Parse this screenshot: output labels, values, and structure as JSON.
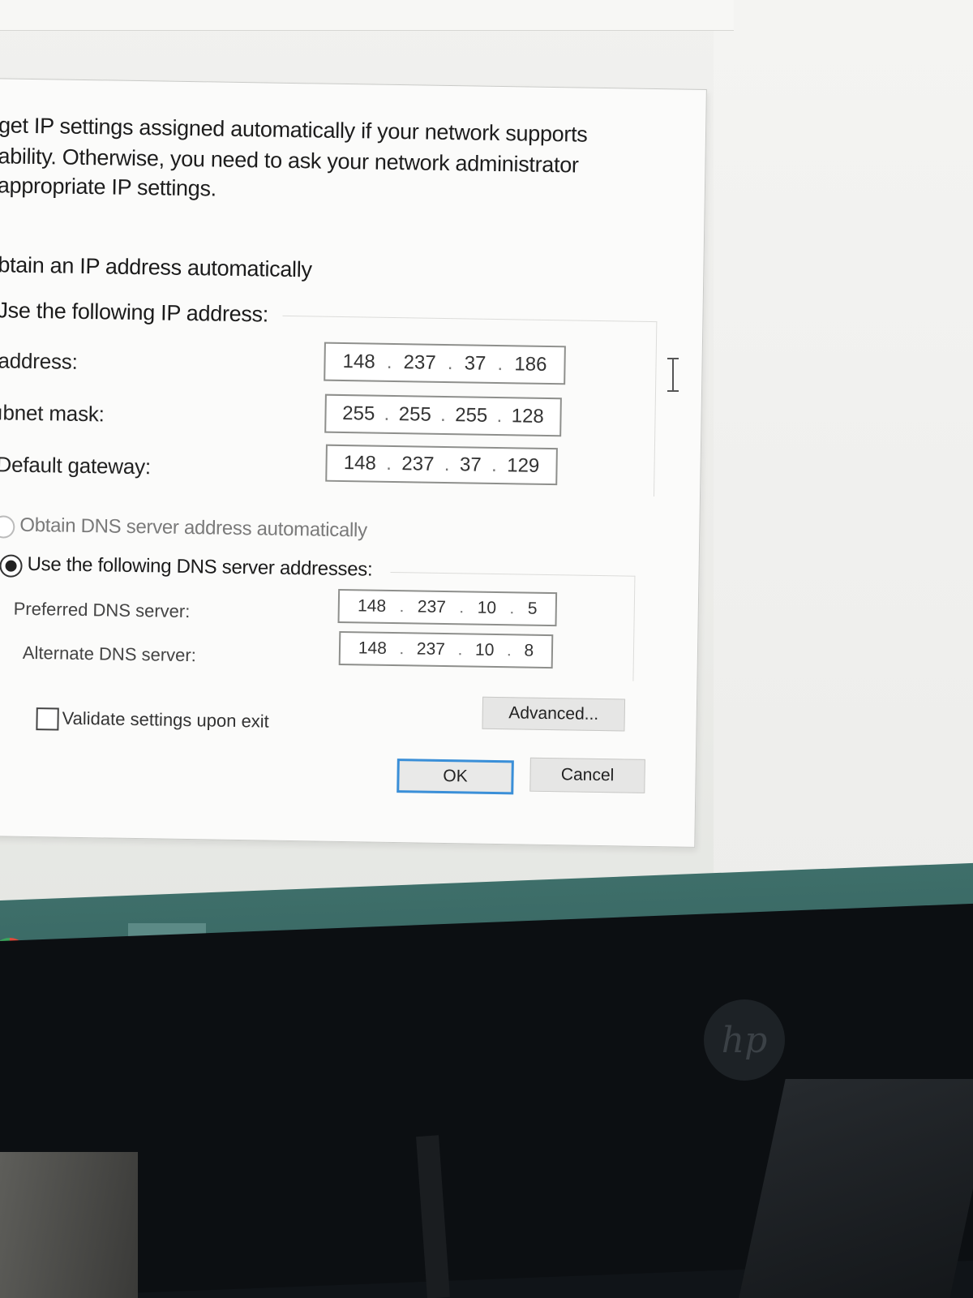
{
  "dialog": {
    "description_lines": [
      "get IP settings assigned automatically if your network supports",
      "ability. Otherwise, you need to ask your network administrator",
      "appropriate IP settings."
    ],
    "radio_auto_ip": "btain an IP address automatically",
    "radio_manual_ip": "Jse the following IP address:",
    "ip_fields": [
      {
        "label": "address:",
        "octets": [
          "148",
          "237",
          "37",
          "186"
        ]
      },
      {
        "label": "ıbnet mask:",
        "octets": [
          "255",
          "255",
          "255",
          "128"
        ]
      },
      {
        "label": "Default gateway:",
        "octets": [
          "148",
          "237",
          "37",
          "129"
        ]
      }
    ],
    "radio_auto_dns": "Obtain DNS server address automatically",
    "radio_manual_dns": "Use the following DNS server addresses:",
    "dns_fields": [
      {
        "label": "Preferred DNS server:",
        "octets": [
          "148",
          "237",
          "10",
          "5"
        ]
      },
      {
        "label": "Alternate DNS server:",
        "octets": [
          "148",
          "237",
          "10",
          "8"
        ]
      }
    ],
    "validate_label": "Validate settings upon exit",
    "validate_checked": false,
    "advanced_label": "Advanced...",
    "ok_label": "OK",
    "cancel_label": "Cancel",
    "selected_ip_mode": "manual",
    "selected_dns_mode": "manual"
  },
  "monitor": {
    "logo": "hp"
  },
  "colors": {
    "taskbar": "#3e6f6a",
    "default_button_border": "#3a8fd8",
    "dialog_bg": "#fbfbfa"
  },
  "icons": [
    "chrome-icon",
    "settings-gear-icon",
    "file-explorer-icon",
    "text-cursor-icon",
    "hp-logo"
  ]
}
